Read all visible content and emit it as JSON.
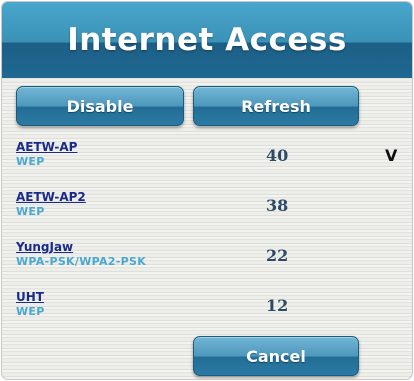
{
  "header": {
    "title": "Internet Access"
  },
  "toolbar": {
    "disable_label": "Disable",
    "refresh_label": "Refresh"
  },
  "networks": [
    {
      "ssid": "AETW-AP",
      "security": "WEP",
      "signal": "40",
      "status": "V"
    },
    {
      "ssid": "AETW-AP2",
      "security": "WEP",
      "signal": "38",
      "status": ""
    },
    {
      "ssid": "YungJaw",
      "security": "WPA-PSK/WPA2-PSK",
      "signal": "22",
      "status": ""
    },
    {
      "ssid": "UHT",
      "security": "WEP",
      "signal": "12",
      "status": ""
    }
  ],
  "footer": {
    "cancel_label": "Cancel"
  },
  "colors": {
    "header": "#3a92b8",
    "button": "#2b7aa3",
    "ssid_link": "#1a2a8a",
    "security_text": "#4aa8d0"
  }
}
